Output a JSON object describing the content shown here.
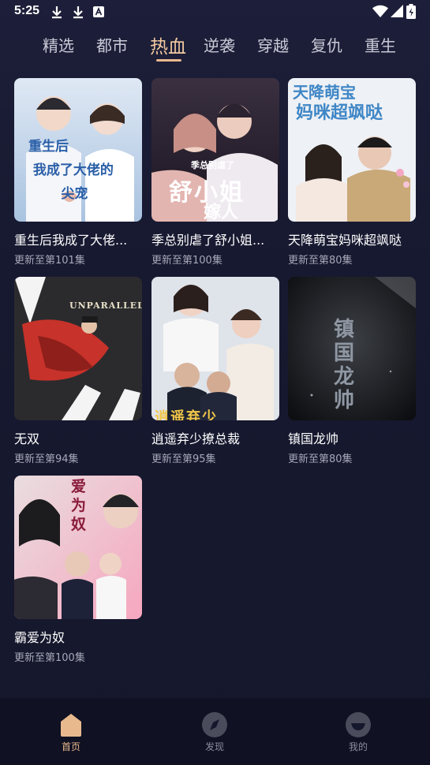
{
  "status_bar": {
    "time": "5:25",
    "left_icons": [
      "download-icon",
      "download-icon",
      "font-icon"
    ],
    "right_icons": [
      "wifi-icon",
      "signal-icon",
      "battery-icon"
    ]
  },
  "tabs": [
    {
      "label": "精选",
      "active": false
    },
    {
      "label": "都市",
      "active": false
    },
    {
      "label": "热血",
      "active": true
    },
    {
      "label": "逆袭",
      "active": false
    },
    {
      "label": "穿越",
      "active": false
    },
    {
      "label": "复仇",
      "active": false
    },
    {
      "label": "重生",
      "active": false
    }
  ],
  "accent_color": "#e9b98e",
  "dramas": [
    {
      "title": "重生后我成了大佬...",
      "subtitle": "更新至第101集",
      "cover_text": "重生后 我成了大佬的 尖宠"
    },
    {
      "title": "季总别虐了舒小姐...",
      "subtitle": "更新至第100集",
      "cover_text": "季总别虐了 舒小姐 嫁人"
    },
    {
      "title": "天降萌宝妈咪超飒哒",
      "subtitle": "更新至第80集",
      "cover_text": "天降萌宝 妈咪超飒哒"
    },
    {
      "title": "无双",
      "subtitle": "更新至第94集",
      "cover_text": "UNPARALLELED"
    },
    {
      "title": "逍遥弃少撩总裁",
      "subtitle": "更新至第95集",
      "cover_text": "逍遥弃少"
    },
    {
      "title": "镇国龙帅",
      "subtitle": "更新至第80集",
      "cover_text": "镇国龙帅"
    },
    {
      "title": "霸爱为奴",
      "subtitle": "更新至第100集",
      "cover_text": "爱为奴"
    }
  ],
  "bottom_nav": [
    {
      "label": "首页",
      "icon": "home-icon",
      "active": true
    },
    {
      "label": "发现",
      "icon": "compass-icon",
      "active": false
    },
    {
      "label": "我的",
      "icon": "profile-icon",
      "active": false
    }
  ]
}
